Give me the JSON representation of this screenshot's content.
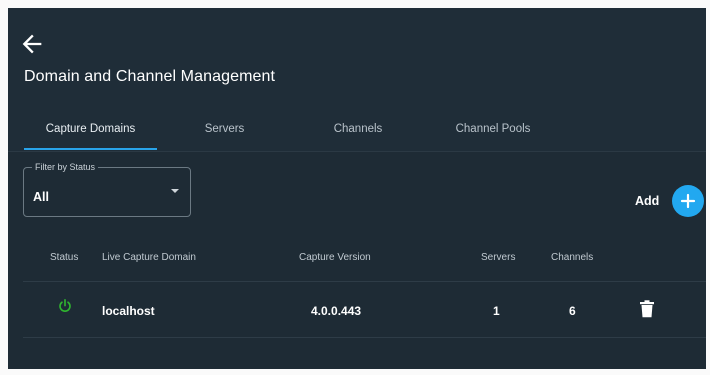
{
  "page": {
    "title": "Domain and Channel Management"
  },
  "tabs": [
    {
      "label": "Capture Domains",
      "active": true
    },
    {
      "label": "Servers",
      "active": false
    },
    {
      "label": "Channels",
      "active": false
    },
    {
      "label": "Channel Pools",
      "active": false
    }
  ],
  "filter": {
    "label": "Filter by Status",
    "value": "All"
  },
  "actions": {
    "add_label": "Add"
  },
  "table": {
    "columns": [
      "Status",
      "Live Capture Domain",
      "Capture Version",
      "Servers",
      "Channels"
    ],
    "rows": [
      {
        "status_icon": "power-icon",
        "status_color": "#2fb52f",
        "domain": "localhost",
        "version": "4.0.0.443",
        "servers": "1",
        "channels": "6"
      }
    ]
  },
  "colors": {
    "background": "#1e2b35",
    "accent": "#22a8f0",
    "tab_indicator": "#29a4ea",
    "status_active": "#2fb52f"
  }
}
